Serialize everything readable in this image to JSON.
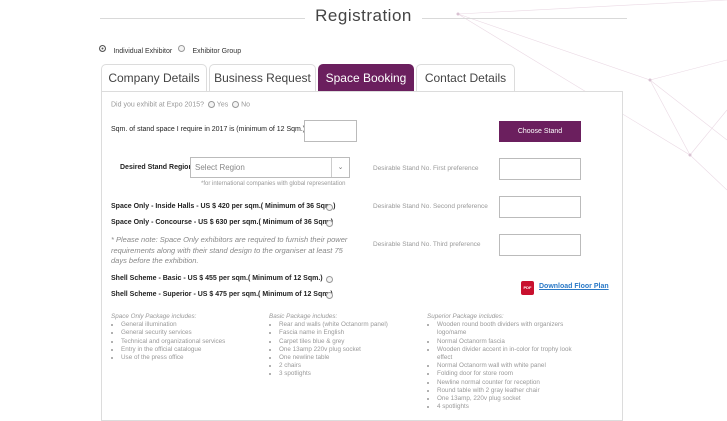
{
  "page": {
    "title": "Registration"
  },
  "exhibitor_type": {
    "options": [
      {
        "label": "Individual Exhibitor",
        "selected": true
      },
      {
        "label": "Exhibitor Group",
        "selected": false
      }
    ]
  },
  "tabs": [
    {
      "label": "Company Details",
      "active": false
    },
    {
      "label": "Business Request",
      "active": false
    },
    {
      "label": "Space Booking",
      "active": true
    },
    {
      "label": "Contact Details",
      "active": false
    }
  ],
  "form": {
    "expo_question": "Did you exhibit at Expo 2015?",
    "yes_label": "Yes",
    "no_label": "No",
    "sqm_label": "Sqm. of stand space I require in 2017 is (minimum of 12 Sqm.)",
    "sqm_value": "",
    "choose_stand_label": "Choose Stand",
    "region_label": "Desired Stand Region",
    "region_placeholder": "Select Region",
    "region_note": "*for international companies with global representation",
    "pref1_label": "Desirable Stand No. First preference",
    "pref2_label": "Desirable Stand No. Second preference",
    "pref3_label": "Desirable Stand No. Third preference",
    "space_inside": "Space Only - Inside Halls - US $ 420 per sqm.( Minimum of 36 Sqm.)",
    "space_concourse": "Space Only - Concourse - US $ 630 per sqm.( Minimum of 36 Sqm.)",
    "note": "* Please note: Space Only exhibitors are required to furnish their power requirements along with their stand design to the organiser at least 75 days before the exhibition.",
    "shell_basic": "Shell Scheme - Basic - US $ 455 per sqm.( Minimum of 12 Sqm.)",
    "shell_superior": "Shell Scheme - Superior - US $ 475 per sqm.( Minimum of 12 Sqm.)",
    "pdf_icon_text": "PDF",
    "download_label": "Download Floor Plan"
  },
  "packages": {
    "space_only": {
      "heading": "Space Only Package includes:",
      "items": [
        "General illumination",
        "General security services",
        "Technical and organizational services",
        "Entry in the official catalogue",
        "Use of the press office"
      ]
    },
    "basic": {
      "heading": "Basic Package includes:",
      "items": [
        "Rear and walls (white Octanorm panel)",
        "Fascia name in English",
        "Carpet tiles blue & grey",
        "One 13amp 220v plug socket",
        "One newline table",
        "2 chairs",
        "3 spotlights"
      ]
    },
    "superior": {
      "heading": "Superior Package includes:",
      "items": [
        "Wooden round booth dividers with organizers logo/name",
        "Normal Octanorm fascia",
        "Wooden divider accent in in-color for trophy look effect",
        "Normal Octanorm wall with white panel",
        "Folding door for store room",
        "Newline normal counter for reception",
        "Round table with 2 gray leather chair",
        "One 13amp, 220v plug socket",
        "4 spotlights"
      ]
    }
  }
}
